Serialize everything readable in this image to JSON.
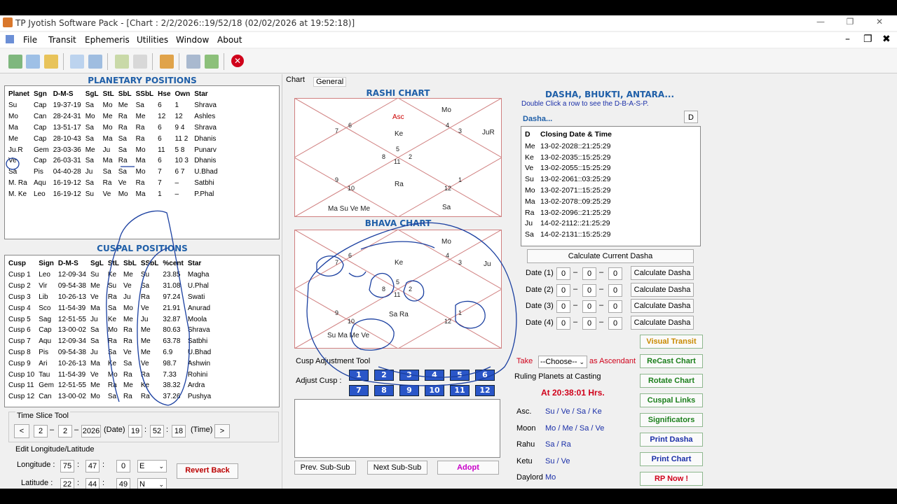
{
  "window": {
    "title": "TP Jyotish Software Pack - [Chart : 2/2/2026::19/52/18 (02/02/2026 at 19:52:18)]",
    "minimize": "—",
    "restore": "❐",
    "close": "✕"
  },
  "menu": [
    "File",
    "Transit",
    "Ephemeris",
    "Utilities",
    "Window",
    "About"
  ],
  "mdi": {
    "min": "–",
    "restore": "❐",
    "close": "✖"
  },
  "toolbar_icons": [
    "new-chart-icon",
    "grid-icon",
    "open-folder-icon",
    "layout-icon",
    "panel-icon",
    "doc-check-icon",
    "list-icon",
    "book-icon",
    "database-icon",
    "refresh-icon",
    "stop-icon"
  ],
  "planetary": {
    "title": "PLANETARY POSITIONS",
    "headers": [
      "Planet",
      "Sgn",
      "D-M-S",
      "SgL",
      "StL",
      "SbL",
      "SSbL",
      "Hse",
      "Own",
      "Star"
    ],
    "rows": [
      [
        "Su",
        "Cap",
        "19-37-19",
        "Sa",
        "Mo",
        "Me",
        "Sa",
        "6",
        "1",
        "Shrava"
      ],
      [
        "Mo",
        "Can",
        "28-24-31",
        "Mo",
        "Me",
        "Ra",
        "Me",
        "12",
        "12",
        "Ashles"
      ],
      [
        "Ma",
        "Cap",
        "13-51-17",
        "Sa",
        "Mo",
        "Ra",
        "Ra",
        "6",
        "9 4",
        "Shrava"
      ],
      [
        "Me",
        "Cap",
        "28-10-43",
        "Sa",
        "Ma",
        "Sa",
        "Ra",
        "6",
        "11 2",
        "Dhanis"
      ],
      [
        "Ju.R",
        "Gem",
        "23-03-36",
        "Me",
        "Ju",
        "Sa",
        "Mo",
        "11",
        "5 8",
        "Punarv"
      ],
      [
        "Ve",
        "Cap",
        "26-03-31",
        "Sa",
        "Ma",
        "Ra",
        "Ma",
        "6",
        "10 3",
        "Dhanis"
      ],
      [
        "Sa",
        "Pis",
        "04-40-28",
        "Ju",
        "Sa",
        "Sa",
        "Mo",
        "7",
        "6 7",
        "U.Bhad"
      ],
      [
        "M. Ra",
        "Aqu",
        "16-19-12",
        "Sa",
        "Ra",
        "Ve",
        "Ra",
        "7",
        "–",
        "Satbhi"
      ],
      [
        "M. Ke",
        "Leo",
        "16-19-12",
        "Su",
        "Ve",
        "Mo",
        "Ma",
        "1",
        "–",
        "P.Phal"
      ]
    ]
  },
  "cuspal": {
    "title": "CUSPAL POSITIONS",
    "headers": [
      "Cusp",
      "Sign",
      "D-M-S",
      "SgL",
      "StL",
      "SbL",
      "SSbL",
      "%cent",
      "Star"
    ],
    "rows": [
      [
        "Cusp 1",
        "Leo",
        "12-09-34",
        "Su",
        "Ke",
        "Me",
        "Su",
        "23.85",
        "Magha"
      ],
      [
        "Cusp 2",
        "Vir",
        "09-54-38",
        "Me",
        "Su",
        "Ve",
        "Sa",
        "31.08",
        "U.Phal"
      ],
      [
        "Cusp 3",
        "Lib",
        "10-26-13",
        "Ve",
        "Ra",
        "Ju",
        "Ra",
        "97.24",
        "Swati"
      ],
      [
        "Cusp 4",
        "Sco",
        "11-54-39",
        "Ma",
        "Sa",
        "Mo",
        "Ve",
        "21.91",
        "Anurad"
      ],
      [
        "Cusp 5",
        "Sag",
        "12-51-55",
        "Ju",
        "Ke",
        "Me",
        "Ju",
        "32.87",
        "Moola"
      ],
      [
        "Cusp 6",
        "Cap",
        "13-00-02",
        "Sa",
        "Mo",
        "Ra",
        "Me",
        "80.63",
        "Shrava"
      ],
      [
        "Cusp 7",
        "Aqu",
        "12-09-34",
        "Sa",
        "Ra",
        "Ra",
        "Me",
        "63.78",
        "Satbhi"
      ],
      [
        "Cusp 8",
        "Pis",
        "09-54-38",
        "Ju",
        "Sa",
        "Ve",
        "Me",
        "6.9",
        "U.Bhad"
      ],
      [
        "Cusp 9",
        "Ari",
        "10-26-13",
        "Ma",
        "Ke",
        "Sa",
        "Ve",
        "98.7",
        "Ashwin"
      ],
      [
        "Cusp 10",
        "Tau",
        "11-54-39",
        "Ve",
        "Mo",
        "Ra",
        "Ra",
        "7.33",
        "Rohini"
      ],
      [
        "Cusp 11",
        "Gem",
        "12-51-55",
        "Me",
        "Ra",
        "Me",
        "Ke",
        "38.32",
        "Ardra"
      ],
      [
        "Cusp 12",
        "Can",
        "13-00-02",
        "Mo",
        "Sa",
        "Ra",
        "Ra",
        "37.26",
        "Pushya"
      ]
    ]
  },
  "timeslice": {
    "title": "Time Slice Tool",
    "prev": "<",
    "next": ">",
    "d": "2",
    "m": "2",
    "y": "2026",
    "date_lbl": "(Date)",
    "h": "19",
    "mi": "52",
    "s": "18",
    "time_lbl": "(Time)",
    "sep_dash": "–",
    "sep_colon": ":"
  },
  "editlon": {
    "title": "Edit Longitude/Latitude",
    "lon_lbl": "Longitude :",
    "lon": [
      "75",
      "47",
      "0"
    ],
    "lon_dir": "E",
    "lat_lbl": "Latitude :",
    "lat": [
      "22",
      "44",
      "49"
    ],
    "lat_dir": "N",
    "revert": "Revert Back",
    "colon": ":"
  },
  "tabs": [
    "Chart",
    "General"
  ],
  "rashi": {
    "title": "RASHI CHART",
    "houses": [
      "Asc",
      "Mo",
      "JuR",
      "Ke",
      "Ra",
      "Ma Su Ve Me",
      "Sa"
    ],
    "nums": [
      "6",
      "4",
      "7",
      "3",
      "5",
      "8",
      "2",
      "11",
      "9",
      "1",
      "10",
      "12"
    ]
  },
  "bhava": {
    "title": "BHAVA CHART",
    "houses": [
      "Mo",
      "Ju",
      "Ke",
      "Sa Ra",
      "Su Ma Me Ve"
    ],
    "nums": [
      "6",
      "4",
      "7",
      "3",
      "5",
      "8",
      "2",
      "11",
      "9",
      "1",
      "10",
      "12"
    ]
  },
  "cuspadj": {
    "title": "Cusp Adjustment Tool",
    "lbl": "Adjust Cusp :",
    "cells": [
      "1",
      "2",
      "3",
      "4",
      "5",
      "6",
      "7",
      "8",
      "9",
      "10",
      "11",
      "12"
    ]
  },
  "subbuttons": {
    "prev": "Prev. Sub-Sub",
    "next": "Next Sub-Sub",
    "adopt": "Adopt"
  },
  "dasha": {
    "title": "DASHA, BHUKTI, ANTARA...",
    "hint": "Double Click a row to see the D-B-A-S-P.",
    "label": "Dasha...",
    "dbtn": "D",
    "headers": [
      "D",
      "Closing Date & Time"
    ],
    "rows": [
      [
        "Me",
        "13-02-2028::21:25:29"
      ],
      [
        "Ke",
        "13-02-2035::15:25:29"
      ],
      [
        "Ve",
        "13-02-2055::15:25:29"
      ],
      [
        "Su",
        "13-02-2061::03:25:29"
      ],
      [
        "Mo",
        "13-02-2071::15:25:29"
      ],
      [
        "Ma",
        "13-02-2078::09:25:29"
      ],
      [
        "Ra",
        "13-02-2096::21:25:29"
      ],
      [
        "Ju",
        "14-02-2112::21:25:29"
      ],
      [
        "Sa",
        "14-02-2131::15:25:29"
      ]
    ],
    "calc_current": "Calculate Current Dasha",
    "dates": [
      {
        "lbl": "Date (1)",
        "v": [
          "0",
          "0",
          "0"
        ]
      },
      {
        "lbl": "Date (2)",
        "v": [
          "0",
          "0",
          "0"
        ]
      },
      {
        "lbl": "Date (3)",
        "v": [
          "0",
          "0",
          "0"
        ]
      },
      {
        "lbl": "Date (4)",
        "v": [
          "0",
          "0",
          "0"
        ]
      }
    ],
    "calc_btn": "Calculate Dasha",
    "dash": "–"
  },
  "right_buttons": [
    "Visual Transit",
    "ReCast Chart",
    "Rotate Chart",
    "Cuspal Links",
    "Significators",
    "Print Dasha",
    "Print Chart",
    "RP Now !"
  ],
  "take": {
    "lbl": "Take",
    "choose": "--Choose--",
    "as": "as Ascendant"
  },
  "ruling": {
    "title": "Ruling Planets at Casting",
    "at": "At  20:38:01 Hrs.",
    "rows": [
      [
        "Asc.",
        "Su / Ve / Sa / Ke"
      ],
      [
        "Moon",
        "Mo / Me / Sa / Ve"
      ],
      [
        "Rahu",
        "Sa / Ra"
      ],
      [
        "Ketu",
        "Su / Ve"
      ],
      [
        "Daylord",
        "Mo"
      ]
    ]
  },
  "colors": {
    "heading": "#1f5fa8",
    "green": "#1b7f1b",
    "blue": "#1a2fa8",
    "red": "#d0021b",
    "gold": "#c98a00",
    "annot": "#1a3fa0"
  }
}
